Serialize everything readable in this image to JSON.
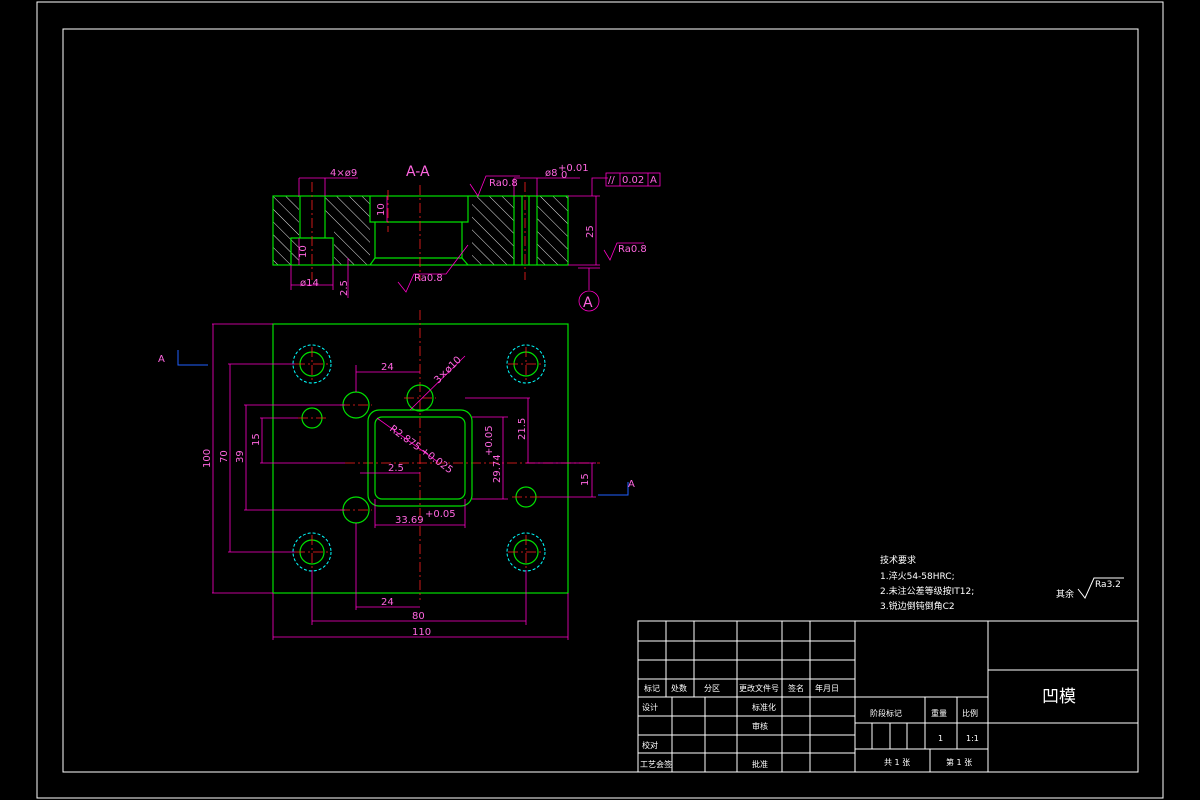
{
  "section_title": "A-A",
  "section_marker": "A",
  "dims": {
    "holes_4x": "4×ø9",
    "bore_cb": "ø14",
    "depth10_a": "10",
    "depth10_b": "10",
    "depth2_5_side": "2.5",
    "thickness": "25",
    "pin_hole": "ø8",
    "pin_tol_upper": "+0.01",
    "pin_tol_lower": "0",
    "rough_top": "Ra0.8",
    "rough_bottom": "Ra0.8",
    "rough_side": "Ra0.8",
    "flatness_sym": "//",
    "flatness_val": "0.02",
    "flatness_ref": "A",
    "d100": "100",
    "d70": "70",
    "d39": "39",
    "d15_left": "15",
    "d24_top": "24",
    "d3x10": "3×ø10",
    "dR": "R2.875",
    "dR_tol": "+0.025",
    "d21_5": "21.5",
    "d29_74": "29.74",
    "d29_tol": "+0.05",
    "d2_5": "2.5",
    "d15_right": "15",
    "d33_69": "33.69",
    "d33_tol": "+0.05",
    "d24_bottom": "24",
    "d80": "80",
    "d110": "110",
    "cut_a_left": "A",
    "cut_a_right": "A"
  },
  "notes": {
    "heading": "技术要求",
    "items": [
      "1.淬火54-58HRC;",
      "2.未注公差等级按IT12;",
      "3.锐边倒钝倒角C2"
    ]
  },
  "surface_finish": {
    "label": "其余",
    "value": "Ra3.2"
  },
  "title_block": {
    "part_name": "凹模",
    "headers": [
      "标记",
      "处数",
      "分区",
      "更改文件号",
      "签名",
      "年月日"
    ],
    "left_labels": [
      "设计",
      "标准化",
      "审核",
      "校对",
      "工艺会签",
      "批准"
    ],
    "stage": "阶段标记",
    "weight": "重量",
    "scale_label": "比例",
    "quantity": "1",
    "scale": "1:1",
    "sheets_total": "共 1 张",
    "sheet_no": "第 1 张"
  },
  "colors": {
    "outline": "#00e000",
    "dimension": "#ff00c8",
    "centerline": "#ff2020",
    "hidden": "#00ffff",
    "frame": "#ffffff"
  }
}
